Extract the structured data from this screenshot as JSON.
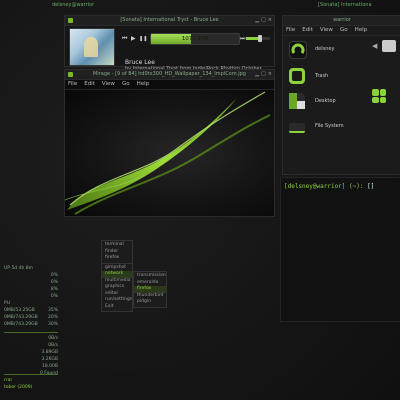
{
  "top_fragments": {
    "left": "delsney@warrior",
    "right1": "[Sonata] Internationa",
    "right2": "[Sonata] Internationa"
  },
  "player": {
    "title": "[Sonata] International Tryst - Bruce Lee",
    "track_title": "Bruce Lee",
    "track_sub": "by International Tryst from Indie/Rock Rhythm October",
    "time": "107 / 240",
    "progress": 0.45,
    "volume": 0.6,
    "controls": {
      "prev": "⏮",
      "play": "▶",
      "pause": "❚❚",
      "stop": "■",
      "next": "⏭"
    }
  },
  "viewer": {
    "title": "Mirage - [9 of 84] hd0tx300_HD_Wallpaper_134_ImpiCom.jpg",
    "menu": [
      "File",
      "Edit",
      "View",
      "Go",
      "Help"
    ]
  },
  "filemanager": {
    "title": "warrior",
    "menu": [
      "File",
      "Edit",
      "View",
      "Go",
      "Help"
    ],
    "items": [
      {
        "label": "delsney",
        "icon": "home-folder-icon",
        "color": "#8cd23c"
      },
      {
        "label": "Trash",
        "icon": "trash-icon",
        "color": "#8cd23c"
      },
      {
        "label": "Desktop",
        "icon": "desktop-folder-icon",
        "color": "#6aa82a"
      },
      {
        "label": "File System",
        "icon": "drive-icon",
        "color": "#8cd23c"
      }
    ]
  },
  "terminal": {
    "prompt": "[delsney@warrior] (~): ",
    "cursor": "[]"
  },
  "menu_main": {
    "items": [
      "terminal",
      "finder",
      "firefox",
      "",
      "gimpshot",
      "network",
      "multimedia",
      "graphics",
      "editor",
      "run/settings",
      "Exit"
    ],
    "selected": "network"
  },
  "menu_sub": {
    "items": [
      "transmission",
      "emeraldo",
      "firefox",
      "thunderbird",
      "pidgin"
    ],
    "selected": "firefox"
  },
  "conky": {
    "rows": [
      {
        "l": "UP 5d 4h 8m",
        "r": ""
      },
      {
        "l": "",
        "r": "0%"
      },
      {
        "l": "",
        "r": "0%"
      },
      {
        "l": "",
        "r": "8%"
      },
      {
        "l": "",
        "r": "0%"
      },
      {
        "l": "PU",
        "r": ""
      },
      {
        "l": "0MB/53.25GB",
        "r": "35%"
      },
      {
        "l": "0MB/743.29GB",
        "r": "20%"
      },
      {
        "l": "0MB/743.29GB",
        "r": "30%"
      },
      {
        "l": "",
        "r": ""
      },
      {
        "l": "",
        "r": "0B/s"
      },
      {
        "l": "",
        "r": "0B/s"
      },
      {
        "l": "",
        "r": "3.89GB"
      },
      {
        "l": "",
        "r": "3.26GB"
      },
      {
        "l": "",
        "r": "18.00B"
      },
      {
        "l": "",
        "r": "0 Found"
      },
      {
        "l": "rrar",
        "r": ""
      },
      {
        "l": "tober (2009)",
        "r": ""
      }
    ]
  },
  "colors": {
    "accent": "#8cd23c",
    "bg": "#141414"
  }
}
